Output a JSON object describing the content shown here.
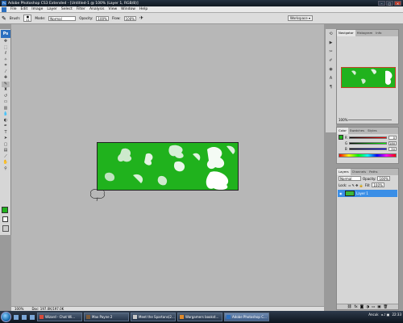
{
  "window": {
    "title": "Adobe Photoshop CS3 Extended - [Untitled-1 @ 100% (Layer 1, RGB/8)]"
  },
  "menu": [
    "File",
    "Edit",
    "Image",
    "Layer",
    "Select",
    "Filter",
    "Analysis",
    "View",
    "Window",
    "Help"
  ],
  "options": {
    "brush_label": "Brush:",
    "brush_size": "11",
    "mode_label": "Mode:",
    "mode_value": "Normal",
    "opacity_label": "Opacity:",
    "opacity_value": "100%",
    "flow_label": "Flow:",
    "flow_value": "100%",
    "workspace_label": "Workspace"
  },
  "document": {
    "zoom": "100%",
    "doc_info": "Doc: 197.0K/197.0K"
  },
  "navigator": {
    "tabs": [
      "Navigator",
      "Histogram",
      "Info"
    ],
    "zoom": "100%"
  },
  "color_panel": {
    "tabs": [
      "Color",
      "Swatches",
      "Styles"
    ],
    "r": "0",
    "g": "180",
    "b": "30"
  },
  "layers": {
    "tabs": [
      "Layers",
      "Channels",
      "Paths"
    ],
    "blend_mode": "Normal",
    "opacity_label": "Opacity:",
    "opacity_value": "100%",
    "lock_label": "Lock:",
    "fill_label": "Fill:",
    "fill_value": "100%",
    "layer_name": "Layer 1"
  },
  "taskbar": {
    "items": [
      {
        "label": "Wizard - Chat Wi...",
        "active": false
      },
      {
        "label": "Max Payne 2",
        "active": false
      },
      {
        "label": "Meet the Spartans(2...",
        "active": false
      },
      {
        "label": "Wargamers bookst...",
        "active": false
      },
      {
        "label": "Adobe Photoshop C...",
        "active": true
      }
    ],
    "lang": "Ancuk",
    "clock": "22:33"
  },
  "colors": {
    "fill_green": "#20b21d",
    "selection_blue": "#3a8ee6"
  }
}
